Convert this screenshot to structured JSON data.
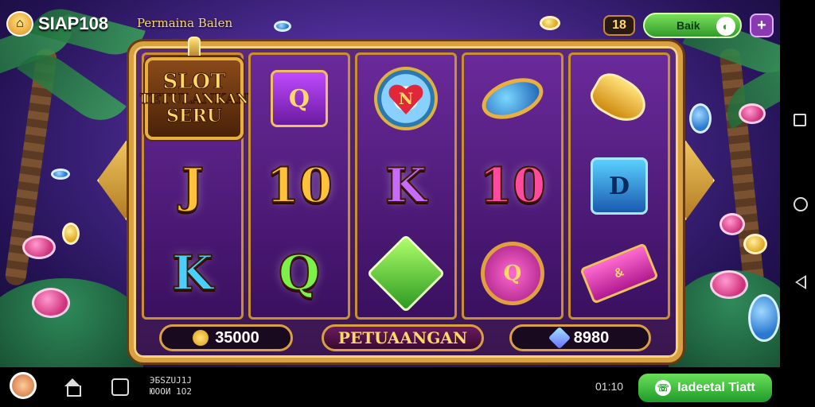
{
  "topbar": {
    "logo_text": "SIAP108",
    "subtitle": "Permaina Balen",
    "counter": "18",
    "action_button_label": "Baik",
    "plus_label": "+"
  },
  "machine": {
    "title_line1": "SLOT",
    "title_line2": "TETULANKAN",
    "title_line3": "SERU",
    "reels": [
      {
        "symbols": [
          "title-plate",
          "J",
          "K"
        ]
      },
      {
        "symbols": [
          "Q",
          "10",
          "Q"
        ]
      },
      {
        "symbols": [
          "N",
          "K",
          "gem"
        ]
      },
      {
        "symbols": [
          "oval-gem",
          "10",
          "Q"
        ]
      },
      {
        "symbols": [
          "horn",
          "D",
          "ticket"
        ]
      }
    ],
    "reel_labels": {
      "r0_mid": "J",
      "r0_bot": "K",
      "r1_top": "Q",
      "r1_mid": "10",
      "r1_bot": "Q",
      "r2_top": "N",
      "r2_mid": "K",
      "r3_mid": "10",
      "r3_bot": "Q",
      "r4_mid": "D",
      "r4_bot": "&"
    },
    "balance": "35000",
    "center_label": "PETUAANGAN",
    "win": "8980"
  },
  "bottombar": {
    "text_line1": "ЭБSZUJ1J",
    "text_line2": "ЮООИ 1О2",
    "time": "01:10",
    "action_label": "Iadeetal Tiatt"
  },
  "colors": {
    "accent_gold": "#d8a040",
    "button_green": "#2f9a2a",
    "frame_purple": "#5a2a7a"
  }
}
